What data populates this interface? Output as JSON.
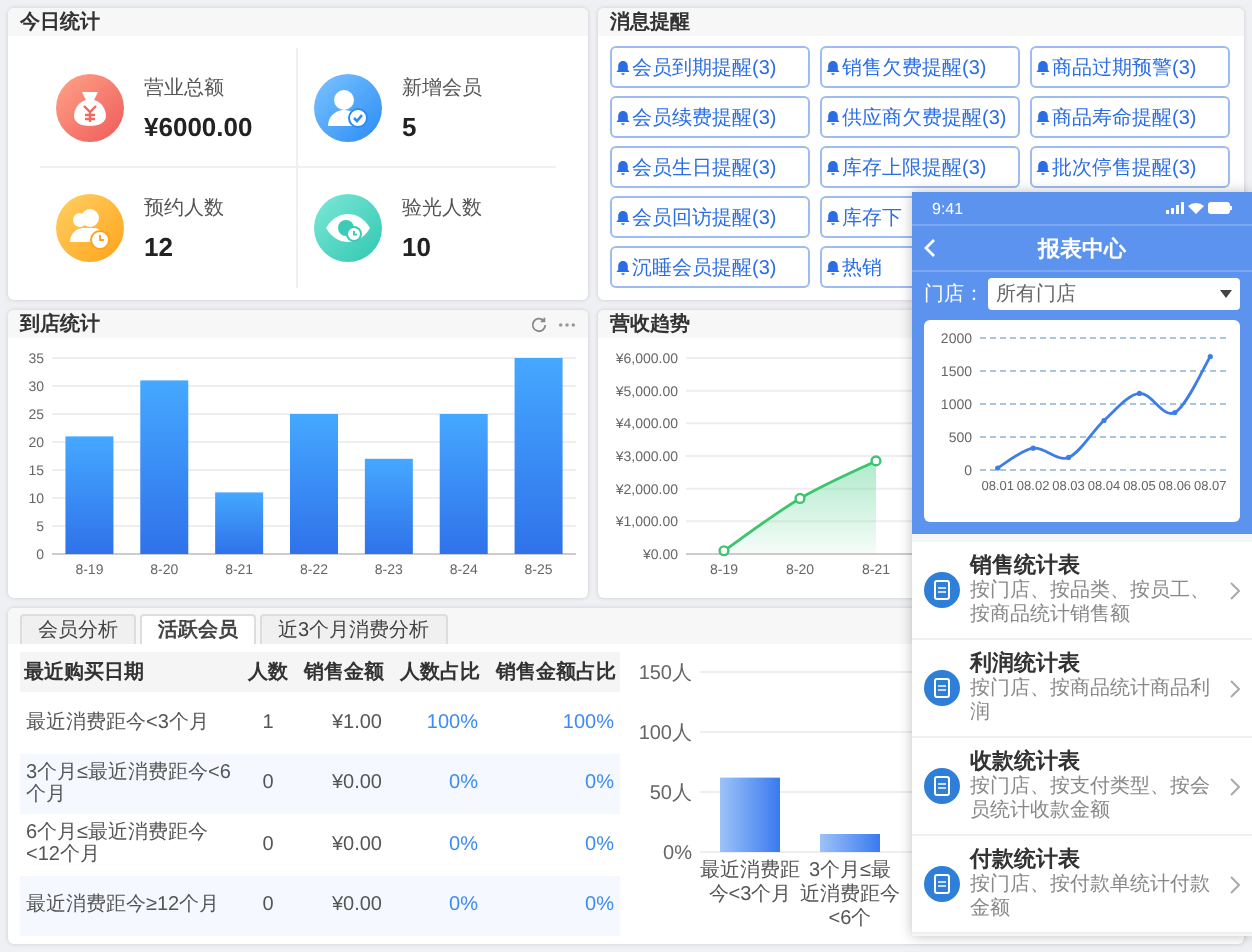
{
  "today_stats": {
    "title": "今日统计",
    "items": [
      {
        "kind": "revenue",
        "label": "营业总额",
        "value": "¥6000.00"
      },
      {
        "kind": "member",
        "label": "新增会员",
        "value": "5"
      },
      {
        "kind": "booking",
        "label": "预约人数",
        "value": "12"
      },
      {
        "kind": "optometry",
        "label": "验光人数",
        "value": "10"
      }
    ]
  },
  "reminders": {
    "title": "消息提醒",
    "rows": [
      [
        "会员到期提醒(3)",
        "销售欠费提醒(3)",
        "商品过期预警(3)"
      ],
      [
        "会员续费提醒(3)",
        "供应商欠费提醒(3)",
        "商品寿命提醒(3)"
      ],
      [
        "会员生日提醒(3)",
        "库存上限提醒(3)",
        "批次停售提醒(3)"
      ],
      [
        "会员回访提醒(3)",
        "库存下"
      ],
      [
        "沉睡会员提醒(3)",
        "热销"
      ]
    ]
  },
  "visits": {
    "title": "到店统计",
    "chart_data": {
      "type": "bar",
      "grid": true,
      "categories": [
        "8-19",
        "8-20",
        "8-21",
        "8-22",
        "8-23",
        "8-24",
        "8-25"
      ],
      "values": [
        21,
        31,
        11,
        25,
        17,
        25,
        35
      ],
      "ylim": [
        0,
        35
      ],
      "yticks": [
        {
          "value": 0,
          "label": "0"
        },
        {
          "value": 5,
          "label": "5"
        },
        {
          "value": 10,
          "label": "10"
        },
        {
          "value": 15,
          "label": "15"
        },
        {
          "value": 20,
          "label": "20"
        },
        {
          "value": 25,
          "label": "25"
        },
        {
          "value": 30,
          "label": "30"
        },
        {
          "value": 35,
          "label": "35"
        }
      ]
    }
  },
  "revenue": {
    "title": "营收趋势",
    "chart_data": {
      "type": "area",
      "grid": true,
      "categories": [
        "8-19",
        "8-20",
        "8-21"
      ],
      "values": [
        100,
        1700,
        2850
      ],
      "ylim": [
        0,
        6000
      ],
      "yticks": [
        {
          "value": 0,
          "label": "¥0.00"
        },
        {
          "value": 1000,
          "label": "¥1,000.00"
        },
        {
          "value": 2000,
          "label": "¥2,000.00"
        },
        {
          "value": 3000,
          "label": "¥3,000.00"
        },
        {
          "value": 4000,
          "label": "¥4,000.00"
        },
        {
          "value": 5000,
          "label": "¥5,000.00"
        },
        {
          "value": 6000,
          "label": "¥6,000.00"
        }
      ]
    }
  },
  "member_analysis": {
    "tabs": [
      {
        "label": "会员分析",
        "selected": false
      },
      {
        "label": "活跃会员",
        "selected": true
      },
      {
        "label": "近3个月消费分析",
        "selected": false
      }
    ],
    "table": {
      "columns": [
        "最近购买日期",
        "人数",
        "销售金额",
        "人数占比",
        "销售金额占比"
      ],
      "rows": [
        [
          "最近消费距今<3个月",
          "1",
          "¥1.00",
          "100%",
          "100%"
        ],
        [
          "3个月≤最近消费距今<6个月",
          "0",
          "¥0.00",
          "0%",
          "0%"
        ],
        [
          "6个月≤最近消费距今<12个月",
          "0",
          "¥0.00",
          "0%",
          "0%"
        ],
        [
          "最近消费距今≥12个月",
          "0",
          "¥0.00",
          "0%",
          "0%"
        ]
      ]
    },
    "chart_data": {
      "type": "bar",
      "grid": true,
      "categories": [
        "最近消费距今<3个月",
        "3个月≤最近消费距今<6个"
      ],
      "values": [
        62,
        15
      ],
      "ylim": [
        0,
        150
      ],
      "yticks": [
        {
          "value": 0,
          "label": "0%"
        },
        {
          "value": 50,
          "label": "50人"
        },
        {
          "value": 100,
          "label": "100人"
        },
        {
          "value": 150,
          "label": "150人"
        }
      ]
    }
  },
  "phone": {
    "status_bar": {
      "time": "9:41"
    },
    "title": "报表中心",
    "store_filter": {
      "label": "门店：",
      "value": "所有门店"
    },
    "chart_data": {
      "type": "line",
      "grid": true,
      "categories": [
        "08.01",
        "08.02",
        "08.03",
        "08.04",
        "08.05",
        "08.06",
        "08.07"
      ],
      "values": [
        30,
        330,
        190,
        750,
        1160,
        870,
        1720
      ],
      "ylim": [
        0,
        2000
      ],
      "yticks": [
        0,
        500,
        1000,
        1500,
        2000
      ]
    },
    "reports": [
      {
        "title": "销售统计表",
        "description": "按门店、按品类、按员工、按商品统计销售额"
      },
      {
        "title": "利润统计表",
        "description": "按门店、按商品统计商品利润"
      },
      {
        "title": "收款统计表",
        "description": "按门店、按支付类型、按会员统计收款金额"
      },
      {
        "title": "付款统计表",
        "description": "按门店、按付款单统计付款金额"
      }
    ]
  }
}
